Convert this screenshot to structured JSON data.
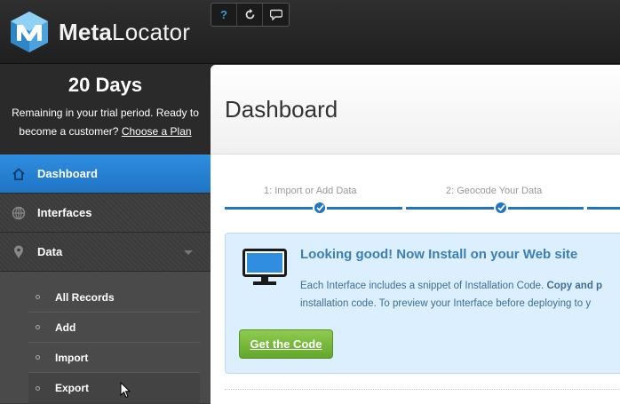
{
  "app": {
    "logo_text_bold": "Meta",
    "logo_text_rest": "Locator",
    "colors": {
      "accent": "#1f74c4",
      "cta": "#62a82c",
      "panel_bg": "#dcefff"
    }
  },
  "toolbar": {
    "help_icon": "?",
    "refresh_icon": "refresh-icon",
    "chat_icon": "chat-icon"
  },
  "trial": {
    "days": "20 Days",
    "text_line1": "Remaining in your trial period. Ready to",
    "text_line2": "become a customer?",
    "link": "Choose a Plan"
  },
  "sidebar": {
    "items": [
      {
        "label": "Dashboard",
        "icon": "home-icon",
        "active": true
      },
      {
        "label": "Interfaces",
        "icon": "globe-icon",
        "active": false
      },
      {
        "label": "Data",
        "icon": "map-pin-icon",
        "active": false
      }
    ],
    "data_subitems": [
      {
        "label": "All Records"
      },
      {
        "label": "Add"
      },
      {
        "label": "Import"
      },
      {
        "label": "Export"
      }
    ]
  },
  "main": {
    "title": "Dashboard",
    "steps": [
      {
        "label": "1: Import or Add Data"
      },
      {
        "label": "2: Geocode Your Data"
      }
    ],
    "panel": {
      "title": "Looking good! Now Install on your Web site",
      "text_line1_start": "Each Interface includes a snippet of Installation Code. ",
      "text_line1_bold": "Copy and p",
      "text_line2": "installation code. To preview your Interface before deploying to y",
      "button": "Get the Code"
    }
  }
}
